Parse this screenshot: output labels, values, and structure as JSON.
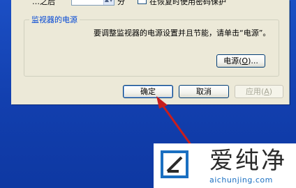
{
  "dialog": {
    "top_left_cut": "…之后",
    "top_mid_cut": "分",
    "top_right_cut": "在恢复时使用密码保护",
    "group_title": "监视器的电源",
    "description": "要调整监视器的电源设置并且节能，请单击“电源”。",
    "power_button_label": "电源",
    "power_button_key": "O",
    "power_button_suffix": "...",
    "ok_label": "确定",
    "cancel_label": "取消",
    "apply_label": "应用",
    "apply_key": "A"
  },
  "watermark": {
    "chinese": "爱纯净",
    "url": "aichunjing.com"
  },
  "colors": {
    "arrow": "#c81e1e",
    "group_title": "#0046d5",
    "desktop": "#123fae"
  }
}
